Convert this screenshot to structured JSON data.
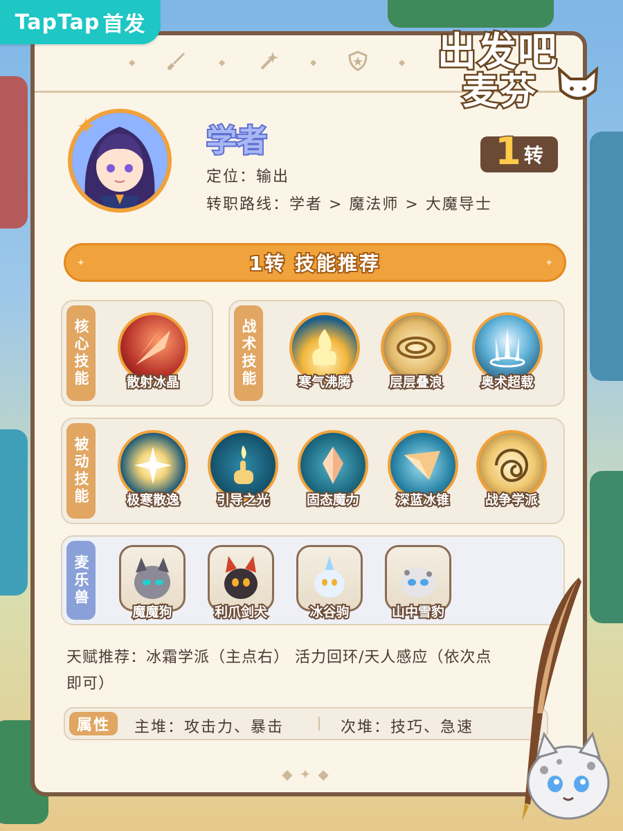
{
  "badge": {
    "brand": "TapTap",
    "suffix": "首发"
  },
  "logo": {
    "line1": "出发吧",
    "line2": "麦芬"
  },
  "header": {
    "class_name": "学者",
    "role_label": "定位：",
    "role_value": "输出",
    "path_label": "转职路线：",
    "path_value": "学者 > 魔法师 > 大魔导士",
    "tier_number": "1",
    "tier_suffix": "转"
  },
  "banner": {
    "title": "1转 技能推荐"
  },
  "groups": {
    "core": {
      "label": "核心技能",
      "skills": [
        {
          "name": "散射冰晶",
          "icon": "ice-shard-icon"
        }
      ]
    },
    "tactical": {
      "label": "战术技能",
      "skills": [
        {
          "name": "寒气沸腾",
          "icon": "flame-icon"
        },
        {
          "name": "层层叠浪",
          "icon": "wave-icon"
        },
        {
          "name": "奥术超载",
          "icon": "arcane-spikes-icon"
        }
      ]
    },
    "passive": {
      "label": "被动技能",
      "skills": [
        {
          "name": "极寒散逸",
          "icon": "burst-icon"
        },
        {
          "name": "引导之光",
          "icon": "finger-light-icon"
        },
        {
          "name": "固态魔力",
          "icon": "crystal-icon"
        },
        {
          "name": "深蓝冰锥",
          "icon": "ice-spear-icon"
        },
        {
          "name": "战争学派",
          "icon": "vortex-icon"
        }
      ]
    },
    "pets": {
      "label": "麦乐兽",
      "items": [
        {
          "name": "魔魔狗",
          "icon": "dark-pup-icon"
        },
        {
          "name": "利爪剑犬",
          "icon": "claw-dog-icon"
        },
        {
          "name": "冰谷驹",
          "icon": "ice-pony-icon"
        },
        {
          "name": "山中雪豹",
          "icon": "snow-leopard-icon"
        }
      ]
    }
  },
  "talent": {
    "text": "天赋推荐：冰霜学派（主点右） 活力回环/天人感应（依次点即可）"
  },
  "attributes": {
    "tag": "属性",
    "primary": "主堆：攻击力、暴击",
    "secondary": "次堆：技巧、急速"
  },
  "colors": {
    "accent": "#f0a23a",
    "frame": "#7a5a43",
    "card": "#fbf5e8",
    "teal": "#1ec6c4",
    "violet": "#5d6fd1"
  }
}
